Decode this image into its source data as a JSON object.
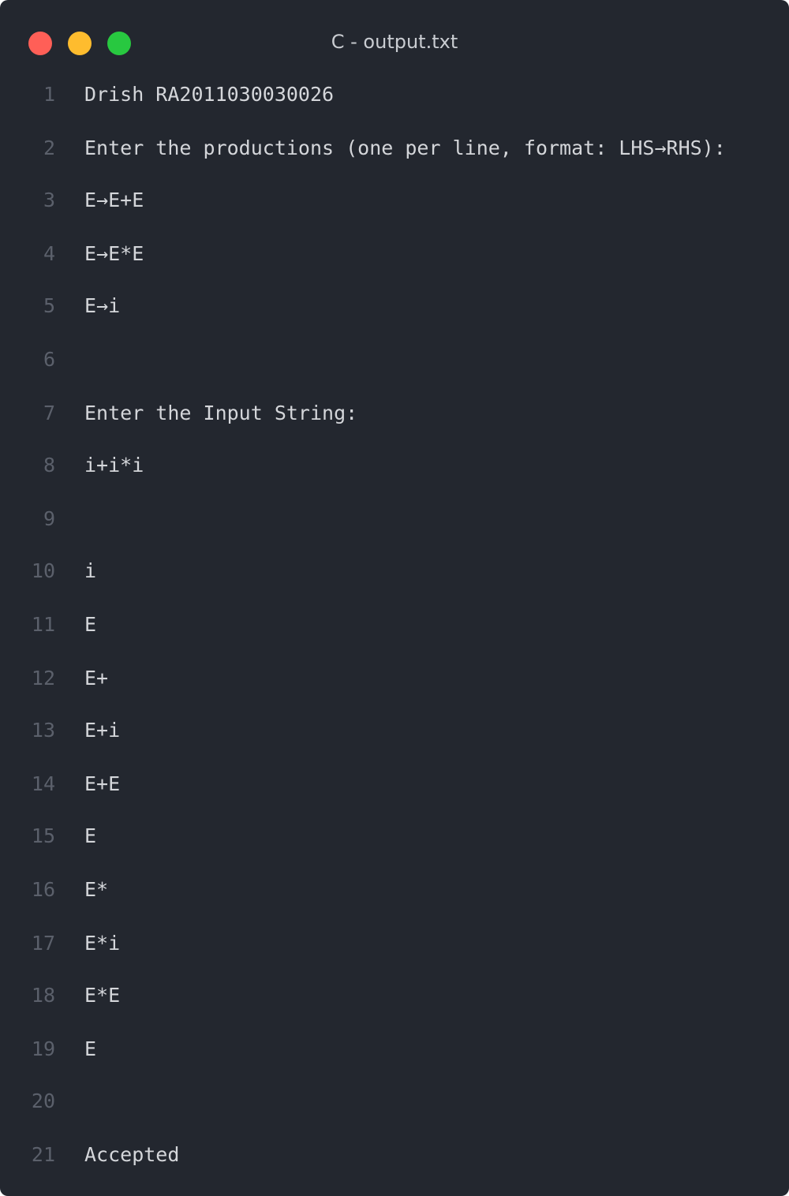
{
  "window": {
    "title": "C - output.txt",
    "controls": {
      "close_color": "#ff5f57",
      "minimize_color": "#febc2e",
      "maximize_color": "#28c840"
    }
  },
  "editor": {
    "lines": [
      {
        "number": "1",
        "text": "Drish RA2011030030026"
      },
      {
        "number": "2",
        "text": "Enter the productions (one per line, format: LHS→RHS):"
      },
      {
        "number": "3",
        "text": "E→E+E"
      },
      {
        "number": "4",
        "text": "E→E*E"
      },
      {
        "number": "5",
        "text": "E→i"
      },
      {
        "number": "6",
        "text": ""
      },
      {
        "number": "7",
        "text": "Enter the Input String:"
      },
      {
        "number": "8",
        "text": "i+i*i"
      },
      {
        "number": "9",
        "text": ""
      },
      {
        "number": "10",
        "text": "i"
      },
      {
        "number": "11",
        "text": "E"
      },
      {
        "number": "12",
        "text": "E+"
      },
      {
        "number": "13",
        "text": "E+i"
      },
      {
        "number": "14",
        "text": "E+E"
      },
      {
        "number": "15",
        "text": "E"
      },
      {
        "number": "16",
        "text": "E*"
      },
      {
        "number": "17",
        "text": "E*i"
      },
      {
        "number": "18",
        "text": "E*E"
      },
      {
        "number": "19",
        "text": "E"
      },
      {
        "number": "20",
        "text": ""
      },
      {
        "number": "21",
        "text": "Accepted"
      }
    ]
  }
}
